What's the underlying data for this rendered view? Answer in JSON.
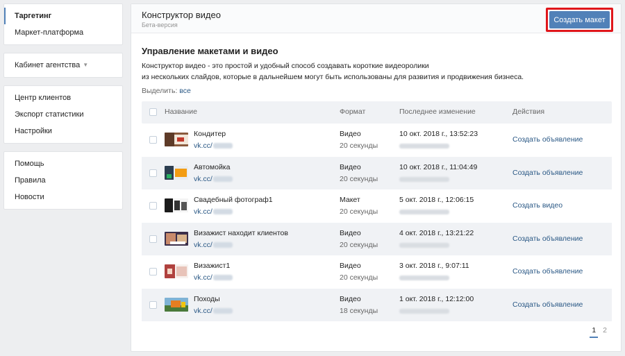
{
  "sidebar": {
    "block1": [
      {
        "label": "Таргетинг"
      },
      {
        "label": "Маркет-платформа"
      }
    ],
    "block2": [
      {
        "label": "Кабинет агентства"
      }
    ],
    "block3": [
      {
        "label": "Центр клиентов"
      },
      {
        "label": "Экспорт статистики"
      },
      {
        "label": "Настройки"
      }
    ],
    "block4": [
      {
        "label": "Помощь"
      },
      {
        "label": "Правила"
      },
      {
        "label": "Новости"
      }
    ]
  },
  "header": {
    "title": "Конструктор видео",
    "subtitle": "Бета-версия",
    "create_button": "Создать макет"
  },
  "main": {
    "section_title": "Управление макетами и видео",
    "description_line1": "Конструктор видео - это простой и удобный способ создавать короткие видеоролики",
    "description_line2": "из нескольких слайдов, которые в дальнейшем могут быть использованы для развития и продвижения бизнеса.",
    "select_label": "Выделить:",
    "select_all": "все"
  },
  "table": {
    "headers": {
      "name": "Название",
      "format": "Формат",
      "modified": "Последнее изменение",
      "actions": "Действия"
    },
    "rows": [
      {
        "name": "Кондитер",
        "link": "vk.cc/",
        "format": "Видео",
        "duration": "20 секунды",
        "date": "10 окт. 2018 г., 13:52:23",
        "action": "Создать объявление"
      },
      {
        "name": "Автомойка",
        "link": "vk.cc/",
        "format": "Видео",
        "duration": "20 секунды",
        "date": "10 окт. 2018 г., 11:04:49",
        "action": "Создать объявление"
      },
      {
        "name": "Свадебный фотограф1",
        "link": "vk.cc/",
        "format": "Макет",
        "duration": "20 секунды",
        "date": "5 окт. 2018 г., 12:06:15",
        "action": "Создать видео"
      },
      {
        "name": "Визажист находит клиентов",
        "link": "vk.cc/",
        "format": "Видео",
        "duration": "20 секунды",
        "date": "4 окт. 2018 г., 13:21:22",
        "action": "Создать объявление"
      },
      {
        "name": "Визажист1",
        "link": "vk.cc/",
        "format": "Видео",
        "duration": "20 секунды",
        "date": "3 окт. 2018 г., 9:07:11",
        "action": "Создать объявление"
      },
      {
        "name": "Походы",
        "link": "vk.cc/",
        "format": "Видео",
        "duration": "18 секунды",
        "date": "1 окт. 2018 г., 12:12:00",
        "action": "Создать объявление"
      }
    ]
  },
  "pagination": {
    "current": "1",
    "next": "2"
  },
  "colors": {
    "accent": "#5181b8",
    "link": "#2a5885",
    "highlight": "#e0161b"
  }
}
